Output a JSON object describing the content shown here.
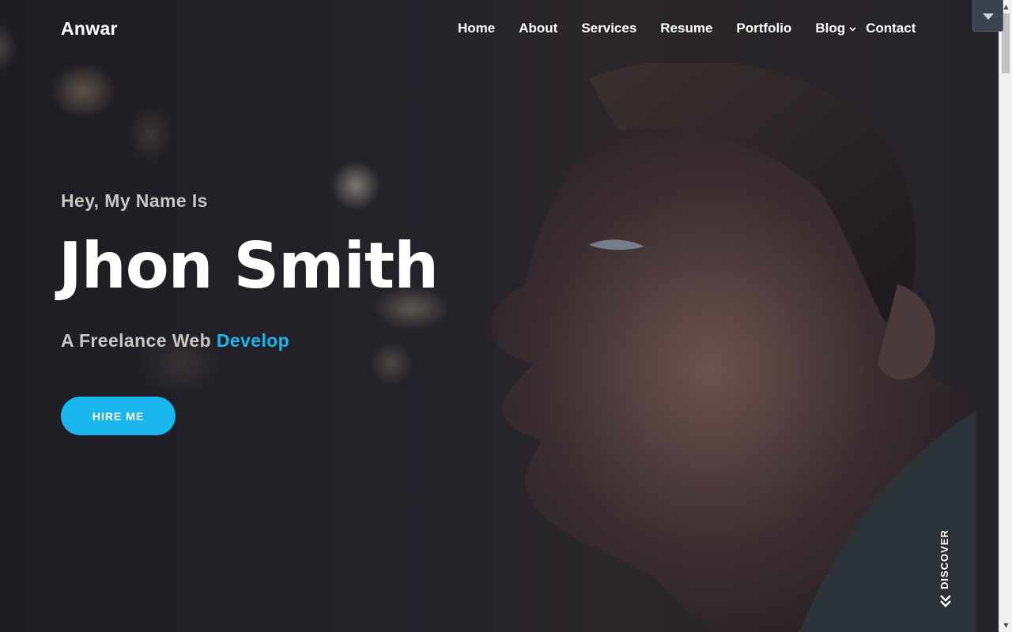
{
  "nav": {
    "brand": "Anwar",
    "items": [
      {
        "label": "Home"
      },
      {
        "label": "About"
      },
      {
        "label": "Services"
      },
      {
        "label": "Resume"
      },
      {
        "label": "Portfolio"
      },
      {
        "label": "Blog"
      },
      {
        "label": "Contact"
      }
    ]
  },
  "hero": {
    "greeting": "Hey, My Name Is",
    "name": "Jhon Smith",
    "role_prefix": "A Freelance Web ",
    "role_highlight": "Develop",
    "cta_label": "HIRE ME",
    "discover_label": "DISCOVER"
  },
  "icons": {
    "blog_dropdown": "chevron-down-icon",
    "discover": "double-chevron-down-icon",
    "top_toggle": "caret-down-icon"
  },
  "colors": {
    "accent": "#1ab6ee",
    "text_light": "#ffffff",
    "text_muted": "#c9c5c3",
    "background": "#1f1e24"
  }
}
